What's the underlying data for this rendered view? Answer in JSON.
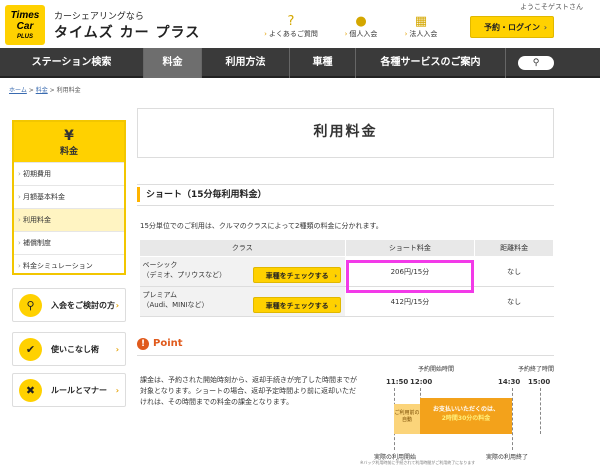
{
  "header": {
    "logo_lines": [
      "Times",
      "Car",
      "PLUS"
    ],
    "brand_sub": "カーシェアリングなら",
    "brand_main": "タイムズ カー プラス",
    "greeting": "ようこそゲストさん",
    "links": [
      {
        "icon": "question-icon",
        "label": "よくあるご質問"
      },
      {
        "icon": "person-icon",
        "label": "個人入会"
      },
      {
        "icon": "building-icon",
        "label": "法人入会"
      }
    ],
    "login_label": "予約・ログイン"
  },
  "nav": {
    "items": [
      "ステーション検索",
      "料金",
      "利用方法",
      "車種",
      "各種サービスのご案内"
    ],
    "active": "料金",
    "search_icon": "search-icon"
  },
  "breadcrumb": {
    "home": "ホーム",
    "fees": "料金",
    "current": "利用料金",
    "sep": ">"
  },
  "sidebar": {
    "title": "料金",
    "icon": "yen-bag-icon",
    "items": [
      "初期費用",
      "月額基本料金",
      "利用料金",
      "補償制度",
      "料金シミュレーション"
    ],
    "current": "利用料金",
    "buttons": [
      {
        "icon": "key-icon",
        "label": "入会をご検討の方"
      },
      {
        "icon": "thumbs-up-icon",
        "label": "使いこなし術"
      },
      {
        "icon": "cross-icon",
        "label": "ルールとマナー"
      }
    ]
  },
  "main": {
    "title": "利用料金",
    "section_title": "ショート（15分毎利用料金）",
    "description": "15分単位でのご利用は、クルマのクラスによって2種類の料金に分かれます。",
    "table": {
      "headers": [
        "クラス",
        "ショート料金",
        "距離料金"
      ],
      "rows": [
        {
          "class_line1": "ベーシック",
          "class_line2": "（デミオ、プリウスなど）",
          "button": "車種をチェックする",
          "fee": "206円/15分",
          "distance": "なし"
        },
        {
          "class_line1": "プレミアム",
          "class_line2": "（Audi、MINIなど）",
          "button": "車種をチェックする",
          "fee": "412円/15分",
          "distance": "なし"
        }
      ]
    },
    "point_title": "Point",
    "point_text": "課金は、予約された開始時刻から、返却手続きが完了した時間までが対象となります。ショートの場合、返却予定時間より前に返却いただけれは、その時間までの料金の課金となります。",
    "timeline": {
      "label_start": "予約開始時間",
      "label_end": "予約終了時間",
      "times": [
        "11:50",
        "12:00",
        "14:30",
        "15:00"
      ],
      "early_label": "ご利用前の自動",
      "pay_line1": "お支払いいただくのは、",
      "pay_line2": "2時間30分の料金",
      "actual_start": "実際の利用開始",
      "actual_end": "実際の利用終了",
      "note": "※バック利用時前に手続されて利用時間がご利用終了になります"
    }
  },
  "colors": {
    "accent": "#ffd100",
    "nav": "#3a3a3a",
    "highlight": "#f23ae8",
    "point": "#e05a1c"
  }
}
